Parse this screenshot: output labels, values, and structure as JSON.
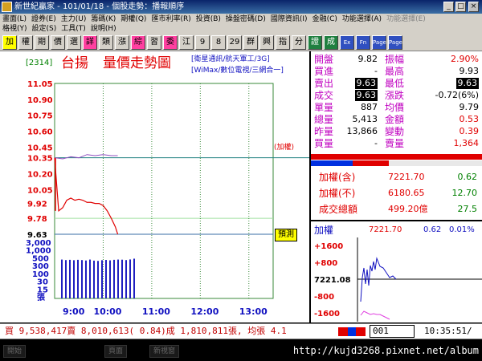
{
  "window": {
    "title": "新世紀贏家 - 101/01/18 - 個股走勢：播報順序",
    "min": "_",
    "max": "□",
    "close": "×"
  },
  "menu": {
    "row1": [
      "畫面(L)",
      "證券(E)",
      "主力(U)",
      "籌碼(K)",
      "期權(Q)",
      "匯市利率(R)",
      "投資(B)",
      "操盤密碼(D)",
      "國際資訊(I)",
      "金融(C)",
      "功能選擇(A)",
      "功能選擇(E)"
    ],
    "row2": [
      "格視(Y)",
      "設定(S)",
      "工具(T)",
      "說明(H)"
    ]
  },
  "toolbar": [
    "加",
    "權",
    "期",
    "價",
    "選",
    "詳",
    "類",
    "漲",
    "綜",
    "習",
    "委",
    "江",
    "9",
    "8",
    "29",
    "群",
    "興",
    "指",
    "分",
    "證",
    "成",
    "Ex",
    "Fn",
    "Page",
    "Page"
  ],
  "chart": {
    "stock_code": "[2314]",
    "stock_name": "台揚",
    "chart_title": "量價走勢圖",
    "concept_line1": "[衛星通訊/航天軍工/3G]",
    "concept_line2": "[WiMax/數位電視/三網合一]",
    "ref_label": "(加權)",
    "weight_tag": "預測",
    "price_ticks": [
      "11.05",
      "10.90",
      "10.75",
      "10.60",
      "10.45",
      "10.35",
      "10.20",
      "10.05",
      "9.92",
      "9.78",
      "9.63"
    ],
    "vol_ticks": [
      "3,000",
      "1,000",
      "500",
      "300",
      "100",
      "30",
      "15",
      "張"
    ],
    "time_ticks": [
      "9:00",
      "10:00",
      "11:00",
      "12:00",
      "13:00"
    ]
  },
  "chart_data": {
    "type": "line",
    "price_axis": {
      "min": 9.63,
      "max": 11.05,
      "ref": 10.35
    },
    "price_series": {
      "name": "價",
      "x_minutes": [
        0,
        5,
        10,
        15,
        20,
        25,
        30,
        35,
        40,
        45,
        50,
        55,
        60,
        65,
        70,
        75,
        78
      ],
      "values": [
        10.35,
        9.85,
        9.88,
        9.95,
        9.97,
        9.95,
        9.96,
        9.95,
        9.93,
        9.93,
        9.92,
        9.92,
        9.9,
        9.85,
        9.78,
        9.7,
        9.63
      ]
    },
    "index_series": {
      "name": "加權",
      "x_minutes": [
        0,
        10,
        20,
        30,
        40,
        50,
        60,
        70,
        78
      ],
      "values": [
        10.35,
        10.34,
        10.36,
        10.35,
        10.38,
        10.37,
        10.38,
        10.37,
        10.37
      ]
    },
    "volume_series": {
      "name": "量",
      "values": [
        520,
        480,
        500,
        470,
        500,
        480,
        450,
        520,
        440,
        420,
        470,
        490,
        460,
        500,
        520,
        510,
        480,
        530,
        600
      ]
    }
  },
  "quote": {
    "rows": [
      {
        "l1": "開盤",
        "v1": "9.82",
        "l2": "振幅",
        "v2": "2.90%"
      },
      {
        "l1": "買進",
        "v1": "-",
        "l2": "最高",
        "v2": "9.93"
      },
      {
        "l1": "賣出",
        "v1": "9.63",
        "l2": "最低",
        "v2": "9.63"
      },
      {
        "l1": "成交",
        "v1": "9.63",
        "l2": "漲跌",
        "v2": "-0.72(6%)"
      },
      {
        "l1": "單量",
        "v1": "887",
        "l2": "均價",
        "v2": "9.79"
      },
      {
        "l1": "總量",
        "v1": "5,413",
        "l2": "金額",
        "v2": "0.53"
      },
      {
        "l1": "昨量",
        "v1": "13,866",
        "l2": "變動",
        "v2": "0.39"
      },
      {
        "l1": "買量",
        "v1": "-",
        "l2": "賣量",
        "v2": "1,364"
      }
    ]
  },
  "index_panel": {
    "rows": [
      {
        "label": "加權(含)",
        "value": "7221.70",
        "delta": "0.62"
      },
      {
        "label": "加權(不)",
        "value": "6180.65",
        "delta": "12.70"
      },
      {
        "label": "成交總額",
        "value": "499.20億",
        "delta": "27.5"
      }
    ],
    "mini_title": "加權",
    "mini_value": "7221.70",
    "mini_change": "0.62",
    "mini_pct": "0.01%",
    "mini_ticks": [
      "+1600",
      "+800",
      "7221.08",
      "-800",
      "-1600"
    ]
  },
  "status": {
    "text": "買 9,538,417賣 8,010,613( 0.84)成 1,810,811張, 均張 4.1",
    "page": "001",
    "clock": "10:35:51/"
  },
  "taskbar": {
    "items": [
      "開始",
      "頁面",
      "新視窗"
    ],
    "watermark": "http://kujd3268.pixnet.net/album"
  },
  "colors": {
    "up": "#e00000",
    "down": "#008000",
    "label": "#c000c0",
    "price_line": "#e00000",
    "index_line": "#9050c0",
    "volume": "#2020c0"
  }
}
